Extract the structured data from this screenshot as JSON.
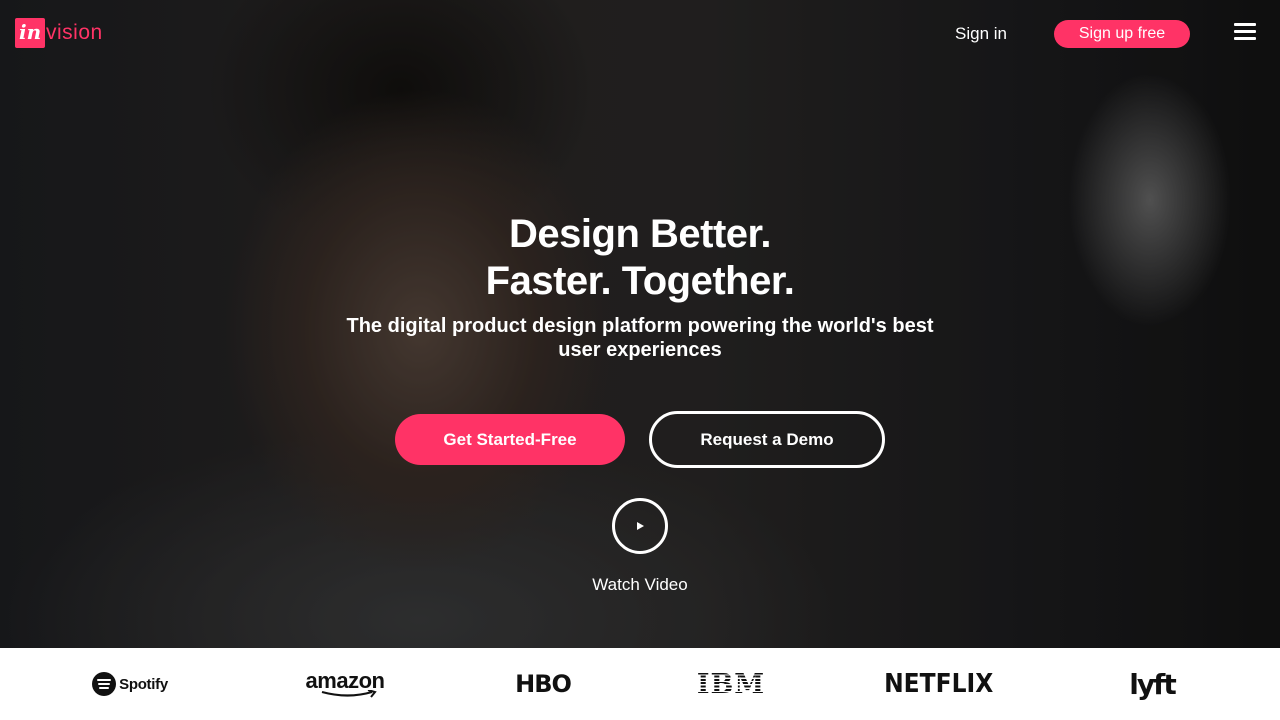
{
  "brand": {
    "logo_mark": "in",
    "logo_word": "vision",
    "accent_color": "#ff3366"
  },
  "nav": {
    "sign_in": "Sign in",
    "sign_up": "Sign up free",
    "menu_icon": "hamburger-menu-icon"
  },
  "hero": {
    "headline_line1": "Design Better.",
    "headline_line2": "Faster. Together.",
    "subheadline": "The digital product design platform powering the world's best user experiences",
    "cta_primary": "Get Started-Free",
    "cta_secondary": "Request a Demo",
    "play_icon": "play-icon",
    "watch_video": "Watch Video"
  },
  "customer_logos": [
    "Spotify",
    "amazon",
    "HBO",
    "IBM",
    "NETFLIX",
    "lyft"
  ]
}
